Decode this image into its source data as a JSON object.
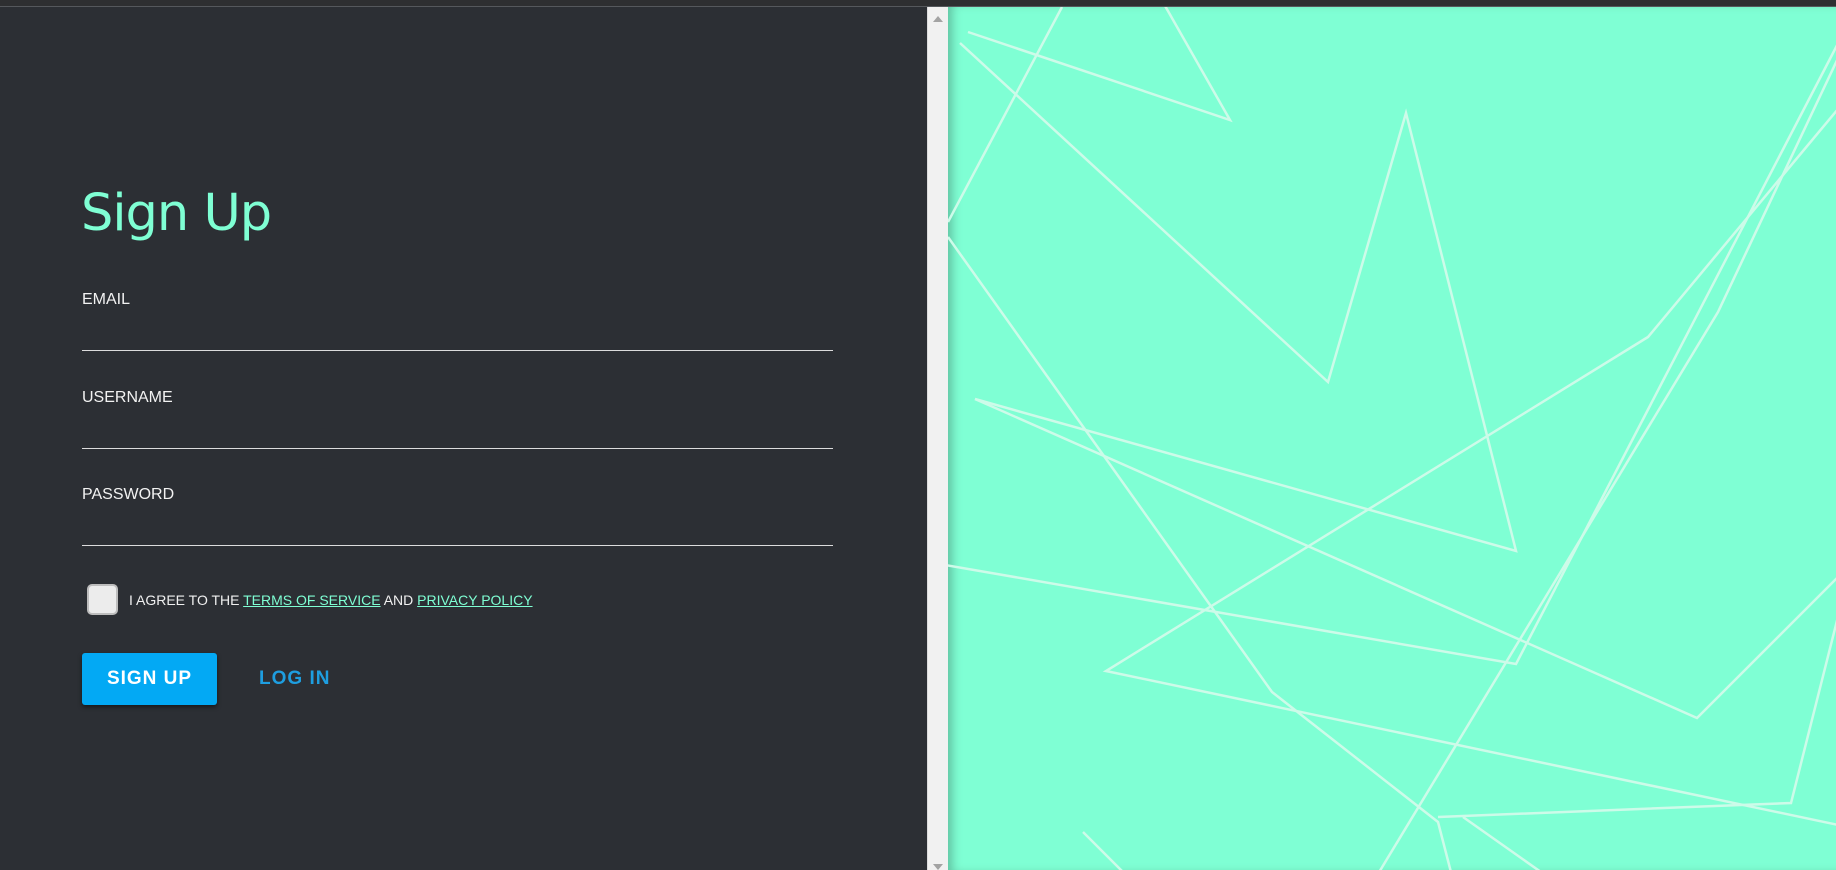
{
  "form": {
    "title": "Sign Up",
    "fields": [
      {
        "label": "EMAIL",
        "value": "",
        "placeholder": ""
      },
      {
        "label": "USERNAME",
        "value": "",
        "placeholder": ""
      },
      {
        "label": "PASSWORD",
        "value": "",
        "placeholder": ""
      }
    ],
    "agreement": {
      "checked": false,
      "prefix": "I AGREE TO THE",
      "terms_link": "TERMS OF SERVICE",
      "conjunction": "AND",
      "privacy_link": "PRIVACY POLICY"
    },
    "signup_button": "SIGN UP",
    "login_button": "LOG IN"
  },
  "colors": {
    "accent": "#7fffd4",
    "primary_button": "#03a9f4",
    "panel_background": "#2c2f34"
  },
  "decoration": {
    "pattern": "geometric-line-pattern"
  }
}
